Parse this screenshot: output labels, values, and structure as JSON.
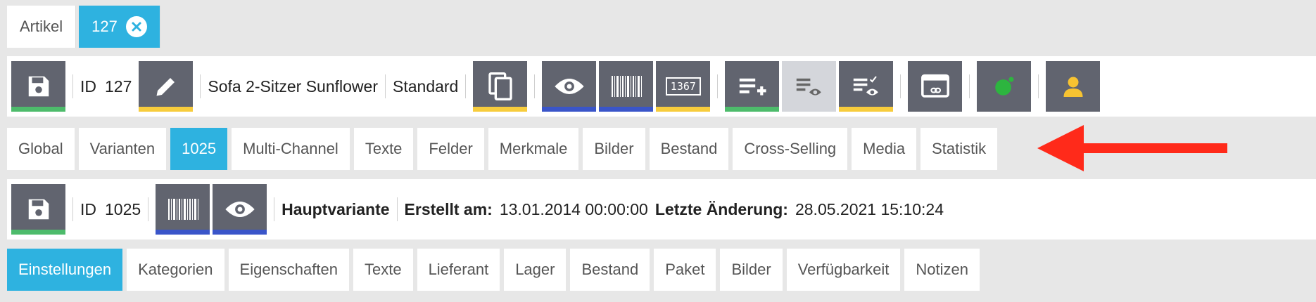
{
  "top_tabs": [
    {
      "label": "Artikel",
      "active": false
    },
    {
      "label": "127",
      "active": true
    }
  ],
  "item_bar": {
    "id_label": "ID",
    "id_value": "127",
    "name": "Sofa 2-Sitzer Sunflower",
    "type": "Standard",
    "tag_value": "1367",
    "buttons": [
      {
        "icon": "save-icon",
        "underline": "green"
      },
      {
        "icon": "pencil-icon",
        "underline": "yellow"
      },
      {
        "icon": "copy-icon",
        "underline": "yellow"
      },
      {
        "icon": "eye-icon",
        "underline": "blue"
      },
      {
        "icon": "barcode-icon",
        "underline": "blue"
      },
      {
        "icon": "number-tag-icon",
        "underline": "yellow"
      },
      {
        "icon": "list-add-icon",
        "underline": "green"
      },
      {
        "icon": "list-view-icon",
        "underline": "none"
      },
      {
        "icon": "list-check-view-icon",
        "underline": "yellow"
      },
      {
        "icon": "window-link-icon",
        "underline": "none"
      },
      {
        "icon": "green-blob-icon",
        "underline": "none"
      },
      {
        "icon": "user-icon",
        "underline": "none"
      }
    ]
  },
  "section_tabs": [
    "Global",
    "Varianten",
    "1025",
    "Multi-Channel",
    "Texte",
    "Felder",
    "Merkmale",
    "Bilder",
    "Bestand",
    "Cross-Selling",
    "Media",
    "Statistik"
  ],
  "section_tabs_active": "1025",
  "variant_bar": {
    "id_label": "ID",
    "id_value": "1025",
    "variant_type": "Hauptvariante",
    "created_label": "Erstellt am:",
    "created_value": "13.01.2014 00:00:00",
    "changed_label": "Letzte Änderung:",
    "changed_value": "28.05.2021 15:10:24"
  },
  "variant_tabs": [
    "Einstellungen",
    "Kategorien",
    "Eigenschaften",
    "Texte",
    "Lieferant",
    "Lager",
    "Bestand",
    "Paket",
    "Bilder",
    "Verfügbarkeit",
    "Notizen"
  ],
  "variant_tabs_active": "Einstellungen",
  "colors": {
    "accent": "#2eb2e0",
    "button": "#61646f",
    "green": "#4dbb6b",
    "yellow": "#f7cc3c",
    "blue": "#3a55c9",
    "arrow": "#ff2a1a"
  }
}
